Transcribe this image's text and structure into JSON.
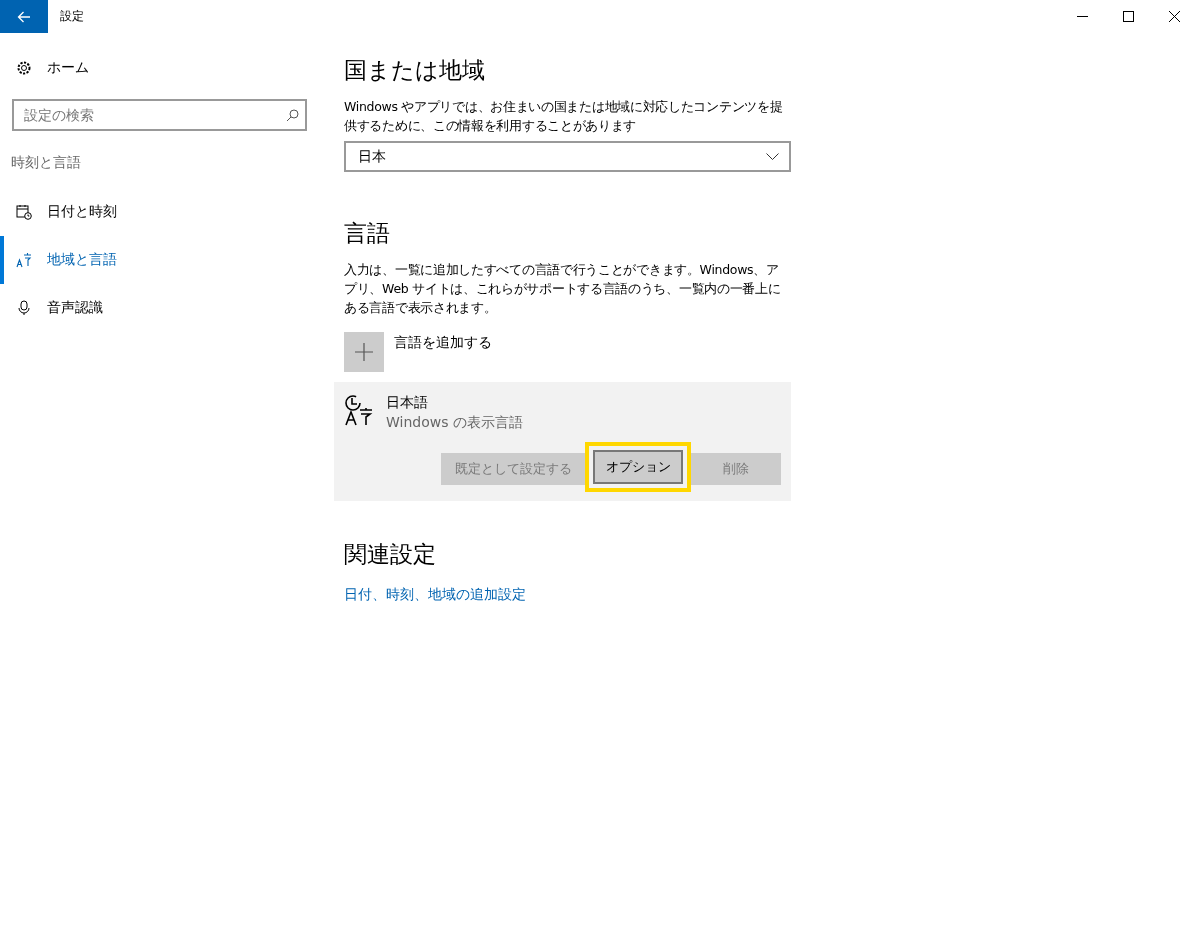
{
  "window": {
    "title": "設定"
  },
  "sidebar": {
    "home": "ホーム",
    "search": {
      "placeholder": "設定の検索"
    },
    "category": "時刻と言語",
    "items": [
      {
        "label": "日付と時刻",
        "kind": "calendar",
        "selected": false
      },
      {
        "label": "地域と言語",
        "kind": "language",
        "selected": true
      },
      {
        "label": "音声認識",
        "kind": "microphone",
        "selected": false
      }
    ]
  },
  "region": {
    "heading": "国または地域",
    "description": "Windows やアプリでは、お住まいの国または地域に対応したコンテンツを提供するために、この情報を利用することがあります",
    "dropdown": {
      "value": "日本"
    }
  },
  "language": {
    "heading": "言語",
    "description": "入力は、一覧に追加したすべての言語で行うことができます。Windows、アプリ、Web サイトは、これらがサポートする言語のうち、一覧内の一番上にある言語で表示されます。",
    "add_label": "言語を追加する",
    "items": [
      {
        "name": "日本語",
        "subtitle": "Windows の表示言語",
        "buttons": [
          {
            "label": "既定として設定する",
            "disabled": true,
            "highlighted": false
          },
          {
            "label": "オプション",
            "disabled": false,
            "highlighted": true
          },
          {
            "label": "削除",
            "disabled": true,
            "highlighted": false
          }
        ]
      }
    ]
  },
  "related": {
    "heading": "関連設定",
    "link": "日付、時刻、地域の追加設定"
  }
}
